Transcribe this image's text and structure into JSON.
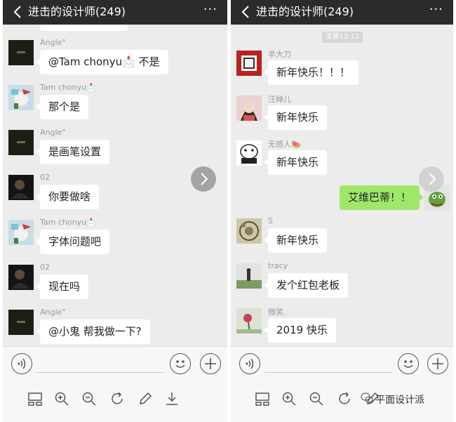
{
  "left": {
    "title": "进击的设计师(249)",
    "messages": [
      {
        "nick": "Angle\"",
        "text": "@Tam chonyu📩 不是"
      },
      {
        "nick": "Tam chonyu📩",
        "text": "那个是"
      },
      {
        "nick": "Angle\"",
        "text": "是画笔设置"
      },
      {
        "nick": "02",
        "text": "你要做啥"
      },
      {
        "nick": "Tam chonyu📩",
        "text": "字体问题吧"
      },
      {
        "nick": "02",
        "text": "现在吗"
      },
      {
        "nick": "Angle\"",
        "text": "@小鬼  帮我做一下?"
      }
    ]
  },
  "right": {
    "title": "进击的设计师(249)",
    "timestamp": "凌晨12:12",
    "messages": [
      {
        "nick": "羊大刀",
        "text": "新年快乐！！！"
      },
      {
        "nick": "汪婵儿",
        "text": "新年快乐"
      },
      {
        "nick": "无感人🍉",
        "text": "新年快乐"
      },
      {
        "nick": "S",
        "text": "新年快乐"
      },
      {
        "nick": "tracy",
        "text": "发个红包老板"
      },
      {
        "nick": "微笑.",
        "text": "2019 快乐"
      }
    ],
    "own_message": "艾维巴蒂！！"
  },
  "header_more": "···",
  "icons": {
    "back": "chevron-left-icon",
    "voice": "voice-icon",
    "emoji": "emoji-icon",
    "plus": "plus-icon",
    "next": "chevron-right-icon"
  },
  "toolbar_icons": [
    "layout-icon",
    "zoom-in-icon",
    "zoom-out-icon",
    "rotate-icon",
    "pencil-icon",
    "download-icon"
  ],
  "watermark": "平面设计派",
  "colors": {
    "header": "#2b2b2b",
    "chat_bg": "#ececec",
    "own_bubble": "#9fe76a"
  }
}
